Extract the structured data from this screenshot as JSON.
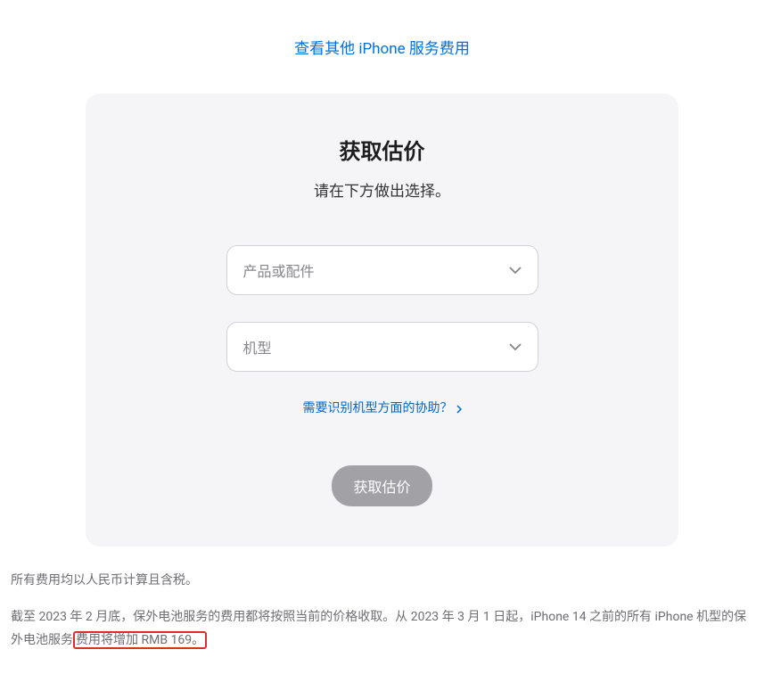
{
  "topLink": {
    "label": "查看其他 iPhone 服务费用"
  },
  "card": {
    "title": "获取估价",
    "subtitle": "请在下方做出选择。",
    "select1": {
      "placeholder": "产品或配件"
    },
    "select2": {
      "placeholder": "机型"
    },
    "helpLink": {
      "label": "需要识别机型方面的协助？"
    },
    "button": {
      "label": "获取估价"
    }
  },
  "notes": {
    "line1": "所有费用均以人民币计算且含税。",
    "line2_part1": "截至 2023 年 2 月底，保外电池服务的费用都将按照当前的价格收取。从 2023 年 3 月 1 日起，iPhone 14 之前的所有 iPhone 机型的保外电池服务",
    "line2_highlight": "费用将增加 RMB 169。"
  }
}
